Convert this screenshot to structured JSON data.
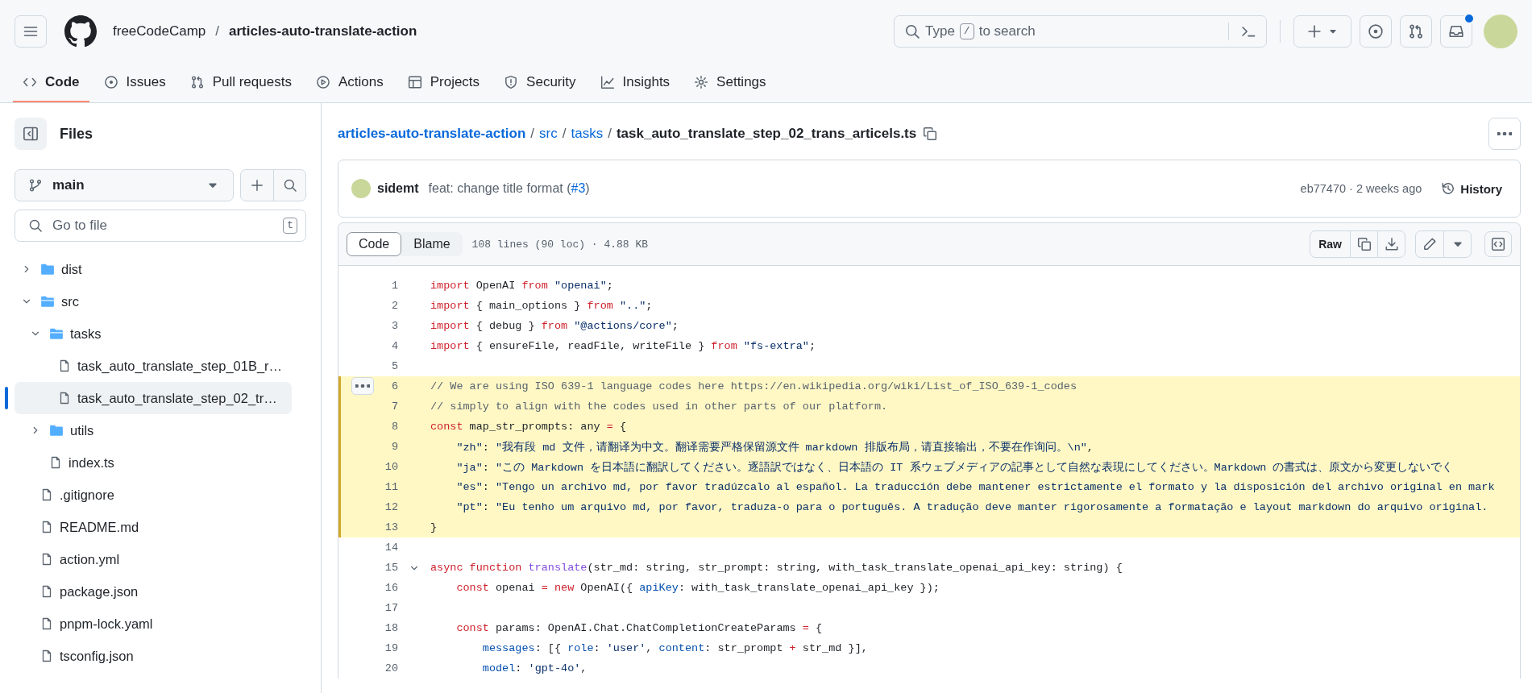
{
  "header": {
    "owner": "freeCodeCamp",
    "separator": "/",
    "repo": "articles-auto-translate-action",
    "search": {
      "text_before": "Type",
      "shortcut_key": "/",
      "text_after": "to search"
    },
    "notifications": {
      "unread": true
    }
  },
  "repo_tabs": [
    {
      "label": "Code",
      "selected": true
    },
    {
      "label": "Issues",
      "selected": false
    },
    {
      "label": "Pull requests",
      "selected": false
    },
    {
      "label": "Actions",
      "selected": false
    },
    {
      "label": "Projects",
      "selected": false
    },
    {
      "label": "Security",
      "selected": false
    },
    {
      "label": "Insights",
      "selected": false
    },
    {
      "label": "Settings",
      "selected": false
    }
  ],
  "sidebar": {
    "title": "Files",
    "branch": "main",
    "go_to_file": {
      "placeholder": "Go to file",
      "shortcut_key": "t"
    },
    "tree": [
      {
        "label": "dist",
        "kind": "folder",
        "expanded": false,
        "selected": false
      },
      {
        "label": "src",
        "kind": "folder",
        "expanded": true,
        "selected": false,
        "children": [
          {
            "label": "tasks",
            "kind": "folder",
            "expanded": true,
            "selected": false,
            "children": [
              {
                "label": "task_auto_translate_step_01B_r…",
                "kind": "file",
                "selected": false
              },
              {
                "label": "task_auto_translate_step_02_tr…",
                "kind": "file",
                "selected": true
              }
            ]
          },
          {
            "label": "utils",
            "kind": "folder",
            "expanded": false,
            "selected": false
          },
          {
            "label": "index.ts",
            "kind": "file",
            "selected": false
          }
        ]
      },
      {
        "label": ".gitignore",
        "kind": "file",
        "selected": false
      },
      {
        "label": "README.md",
        "kind": "file",
        "selected": false
      },
      {
        "label": "action.yml",
        "kind": "file",
        "selected": false
      },
      {
        "label": "package.json",
        "kind": "file",
        "selected": false
      },
      {
        "label": "pnpm-lock.yaml",
        "kind": "file",
        "selected": false
      },
      {
        "label": "tsconfig.json",
        "kind": "file",
        "selected": false
      }
    ]
  },
  "breadcrumb": {
    "parts": [
      "articles-auto-translate-action",
      "src",
      "tasks"
    ],
    "separator": "/",
    "file": "task_auto_translate_step_02_trans_articels.ts"
  },
  "commit": {
    "author": "sidemt",
    "message_before": "feat: change title format (",
    "pr_link": "#3",
    "message_after": ")",
    "info": "eb77470 · 2 weeks ago",
    "history_label": "History"
  },
  "file_view": {
    "view_tabs": [
      {
        "label": "Code",
        "selected": true
      },
      {
        "label": "Blame",
        "selected": false
      }
    ],
    "file_info": "108 lines (90 loc) · 4.88 KB",
    "raw_label": "Raw"
  },
  "code_lines": [
    {
      "number": "1",
      "highlighted": false,
      "tokens": [
        {
          "kind": "keyword",
          "text": "import"
        },
        {
          "kind": "plain",
          "text": " OpenAI "
        },
        {
          "kind": "keyword",
          "text": "from"
        },
        {
          "kind": "string",
          "text": " \"openai\""
        },
        {
          "kind": "plain",
          "text": ";"
        }
      ]
    },
    {
      "number": "2",
      "highlighted": false,
      "tokens": [
        {
          "kind": "keyword",
          "text": "import"
        },
        {
          "kind": "plain",
          "text": " { main_options } "
        },
        {
          "kind": "keyword",
          "text": "from"
        },
        {
          "kind": "string",
          "text": " \"..\""
        },
        {
          "kind": "plain",
          "text": ";"
        }
      ]
    },
    {
      "number": "3",
      "highlighted": false,
      "tokens": [
        {
          "kind": "keyword",
          "text": "import"
        },
        {
          "kind": "plain",
          "text": " { debug } "
        },
        {
          "kind": "keyword",
          "text": "from"
        },
        {
          "kind": "string",
          "text": " \"@actions/core\""
        },
        {
          "kind": "plain",
          "text": ";"
        }
      ]
    },
    {
      "number": "4",
      "highlighted": false,
      "tokens": [
        {
          "kind": "keyword",
          "text": "import"
        },
        {
          "kind": "plain",
          "text": " { ensureFile, readFile, writeFile } "
        },
        {
          "kind": "keyword",
          "text": "from"
        },
        {
          "kind": "string",
          "text": " \"fs-extra\""
        },
        {
          "kind": "plain",
          "text": ";"
        }
      ]
    },
    {
      "number": "5",
      "highlighted": false
    },
    {
      "number": "6",
      "highlighted": true,
      "tokens": [
        {
          "kind": "comment",
          "text": "// We are using ISO 639-1 language codes here https://en.wikipedia.org/wiki/List_of_ISO_639-1_codes"
        }
      ]
    },
    {
      "number": "7",
      "highlighted": true,
      "tokens": [
        {
          "kind": "comment",
          "text": "// simply to align with the codes used in other parts of our platform."
        }
      ]
    },
    {
      "number": "8",
      "highlighted": true,
      "tokens": [
        {
          "kind": "keyword",
          "text": "const"
        },
        {
          "kind": "plain",
          "text": " map_str_prompts: any "
        },
        {
          "kind": "keyword",
          "text": "="
        },
        {
          "kind": "plain",
          "text": " {"
        }
      ]
    },
    {
      "number": "9",
      "highlighted": true,
      "tokens": [
        {
          "kind": "string",
          "text": "    \"zh\""
        },
        {
          "kind": "plain",
          "text": ": "
        },
        {
          "kind": "string",
          "text": "\"我有段 md 文件，请翻译为中文。翻译需要严格保留源文件 markdown 排版布局，请直接输出，不要在作询问。\\n\""
        },
        {
          "kind": "plain",
          "text": ","
        }
      ]
    },
    {
      "number": "10",
      "highlighted": true,
      "tokens": [
        {
          "kind": "string",
          "text": "    \"ja\""
        },
        {
          "kind": "plain",
          "text": ": "
        },
        {
          "kind": "string",
          "text": "\"この Markdown を日本語に翻訳してください。逐語訳ではなく、日本語の IT 系ウェブメディアの記事として自然な表現にしてください。Markdown の書式は、原文から変更しないでく"
        }
      ]
    },
    {
      "number": "11",
      "highlighted": true,
      "tokens": [
        {
          "kind": "string",
          "text": "    \"es\""
        },
        {
          "kind": "plain",
          "text": ": "
        },
        {
          "kind": "string",
          "text": "\"Tengo un archivo md, por favor tradúzcalo al español. La traducción debe mantener estrictamente el formato y la disposición del archivo original en mark"
        }
      ]
    },
    {
      "number": "12",
      "highlighted": true,
      "tokens": [
        {
          "kind": "string",
          "text": "    \"pt\""
        },
        {
          "kind": "plain",
          "text": ": "
        },
        {
          "kind": "string",
          "text": "\"Eu tenho um arquivo md, por favor, traduza-o para o português. A tradução deve manter rigorosamente a formatação e layout markdown do arquivo original."
        }
      ]
    },
    {
      "number": "13",
      "highlighted": true,
      "tokens": [
        {
          "kind": "plain",
          "text": "}"
        }
      ]
    },
    {
      "number": "14",
      "highlighted": false
    },
    {
      "number": "15",
      "highlighted": false,
      "fold": {
        "expanded": true
      },
      "tokens": [
        {
          "kind": "keyword",
          "text": "async function"
        },
        {
          "kind": "function",
          "text": " translate"
        },
        {
          "kind": "plain",
          "text": "(str_md: string, str_prompt: string, with_task_translate_openai_api_key: string) {"
        }
      ]
    },
    {
      "number": "16",
      "highlighted": false,
      "tokens": [
        {
          "kind": "keyword",
          "text": "    const"
        },
        {
          "kind": "plain",
          "text": " openai "
        },
        {
          "kind": "keyword",
          "text": "= new"
        },
        {
          "kind": "plain",
          "text": " OpenAI({ "
        },
        {
          "kind": "property",
          "text": "apiKey"
        },
        {
          "kind": "plain",
          "text": ": with_task_translate_openai_api_key });"
        }
      ]
    },
    {
      "number": "17",
      "highlighted": false
    },
    {
      "number": "18",
      "highlighted": false,
      "tokens": [
        {
          "kind": "keyword",
          "text": "    const"
        },
        {
          "kind": "plain",
          "text": " params: OpenAI.Chat.ChatCompletionCreateParams "
        },
        {
          "kind": "keyword",
          "text": "="
        },
        {
          "kind": "plain",
          "text": " {"
        }
      ]
    },
    {
      "number": "19",
      "highlighted": false,
      "tokens": [
        {
          "kind": "property",
          "text": "        messages"
        },
        {
          "kind": "plain",
          "text": ": [{ "
        },
        {
          "kind": "property",
          "text": "role"
        },
        {
          "kind": "plain",
          "text": ": "
        },
        {
          "kind": "string",
          "text": "'user'"
        },
        {
          "kind": "plain",
          "text": ", "
        },
        {
          "kind": "property",
          "text": "content"
        },
        {
          "kind": "plain",
          "text": ": str_prompt "
        },
        {
          "kind": "keyword",
          "text": "+"
        },
        {
          "kind": "plain",
          "text": " str_md }],"
        }
      ]
    },
    {
      "number": "20",
      "highlighted": false,
      "tokens": [
        {
          "kind": "property",
          "text": "        model"
        },
        {
          "kind": "plain",
          "text": ": "
        },
        {
          "kind": "string",
          "text": "'gpt-4o'"
        },
        {
          "kind": "plain",
          "text": ","
        }
      ]
    }
  ]
}
